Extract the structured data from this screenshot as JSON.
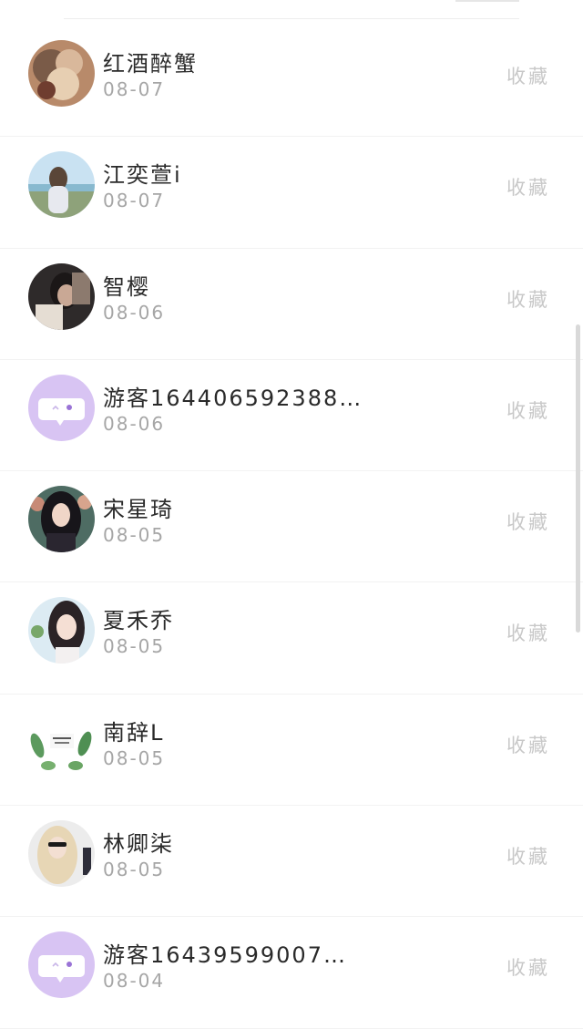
{
  "items": [
    {
      "name": "红酒醉蟹",
      "date": "08-07",
      "action": "收藏",
      "avatar": "photo-avatar"
    },
    {
      "name": "江奕萱i",
      "date": "08-07",
      "action": "收藏",
      "avatar": "photo-avatar"
    },
    {
      "name": "智樱",
      "date": "08-06",
      "action": "收藏",
      "avatar": "photo-avatar"
    },
    {
      "name": "游客164406592388…",
      "date": "08-06",
      "action": "收藏",
      "avatar": "guest-chat-avatar"
    },
    {
      "name": "宋星琦",
      "date": "08-05",
      "action": "收藏",
      "avatar": "photo-avatar"
    },
    {
      "name": "夏禾乔",
      "date": "08-05",
      "action": "收藏",
      "avatar": "photo-avatar"
    },
    {
      "name": "南辞L",
      "date": "08-05",
      "action": "收藏",
      "avatar": "leaf-avatar"
    },
    {
      "name": "林卿柒",
      "date": "08-05",
      "action": "收藏",
      "avatar": "photo-avatar"
    },
    {
      "name": "游客16439599007…",
      "date": "08-04",
      "action": "收藏",
      "avatar": "guest-chat-avatar"
    }
  ],
  "colors": {
    "guest_avatar": "#d8c4f3",
    "name_text": "#2a2a2a",
    "date_text": "#a6a6a6",
    "action_text": "#c8c8c8"
  }
}
